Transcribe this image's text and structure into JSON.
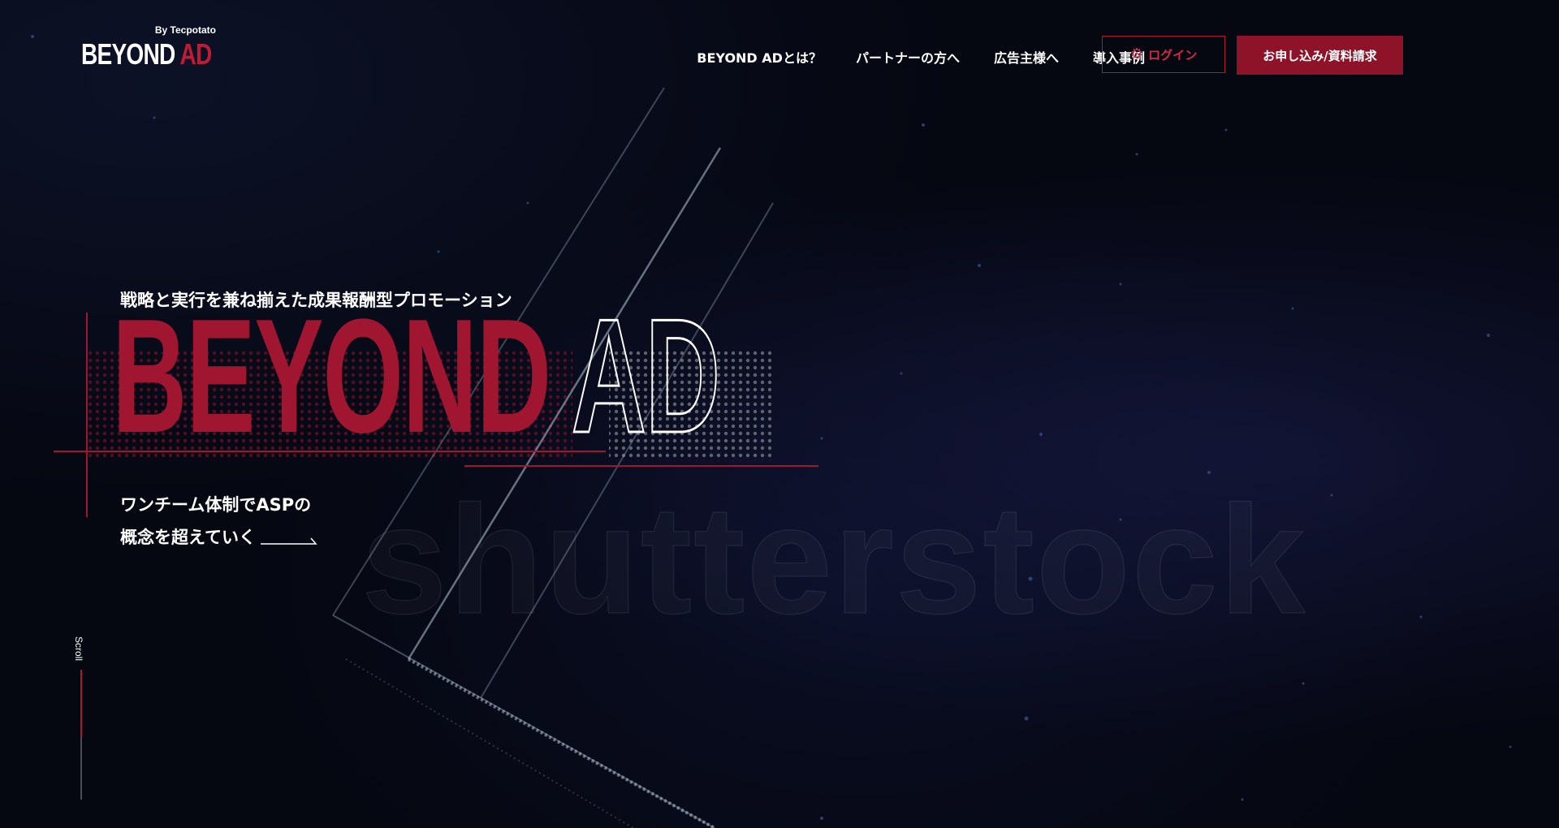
{
  "header": {
    "logo_by": "By Tecpotato",
    "logo_word1": "BEYOND",
    "logo_word2": "AD",
    "nav": [
      {
        "label": "BEYOND ADとは？"
      },
      {
        "label": "パートナーの方へ"
      },
      {
        "label": "広告主様へ"
      },
      {
        "label": "導入事例"
      }
    ],
    "login_label": "ログイン",
    "login_icon": "gear-icon",
    "apply_label": "お申し込み/資料請求"
  },
  "hero": {
    "subtitle": "戦略と実行を兼ね揃えた成果報酬型プロモーション",
    "title_word1": "BEYOND",
    "title_word2": "AD",
    "description_line1": "ワンチーム体制でASPの",
    "description_line2": "概念を超えていく",
    "watermark": "shutterstock"
  },
  "scroll": {
    "label": "Scroll",
    "progress": 0.52
  },
  "colors": {
    "accent": "#a0152f",
    "button_bg": "#8e1228",
    "background": "#050711"
  }
}
